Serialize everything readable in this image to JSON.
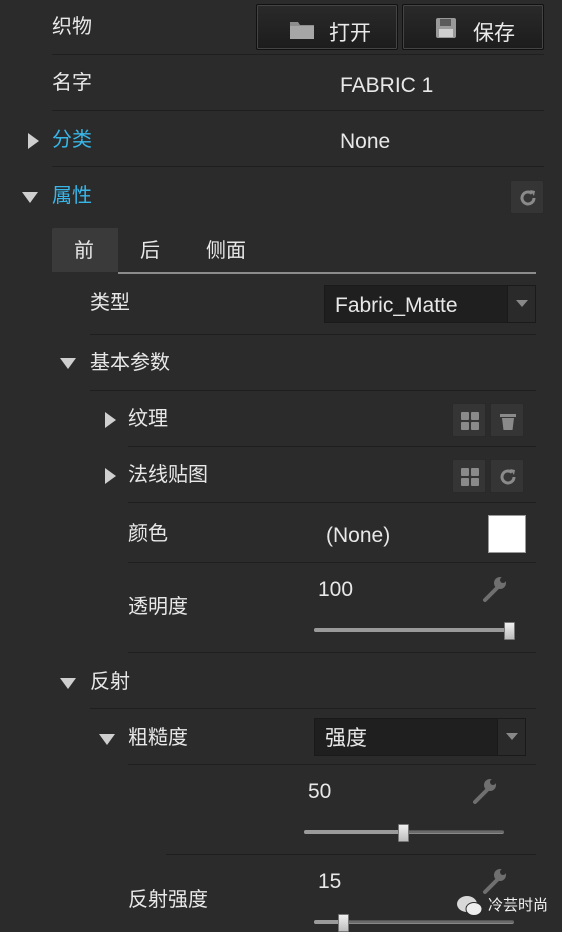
{
  "header": {
    "fabric_label": "织物",
    "open_label": "打开",
    "save_label": "保存"
  },
  "name_row": {
    "label": "名字",
    "value": "FABRIC 1"
  },
  "category_row": {
    "label": "分类",
    "value": "None"
  },
  "properties": {
    "label": "属性",
    "tabs": [
      "前",
      "后",
      "侧面"
    ],
    "type": {
      "label": "类型",
      "value": "Fabric_Matte"
    },
    "basic": {
      "label": "基本参数",
      "texture_label": "纹理",
      "normal_map_label": "法线贴图",
      "color": {
        "label": "颜色",
        "value": "(None)",
        "swatch": "#ffffff"
      },
      "opacity": {
        "label": "透明度",
        "value": "100",
        "level": 1.0
      }
    },
    "reflection": {
      "label": "反射",
      "roughness": {
        "label": "粗糙度",
        "mode": "强度",
        "value": "50",
        "level": 0.5
      },
      "intensity": {
        "label": "反射强度",
        "value": "15",
        "level": 0.15
      }
    }
  },
  "watermark": {
    "text": "冷芸时尚"
  },
  "colors": {
    "accent": "#38b6e8",
    "panel": "#2b2b2b"
  }
}
